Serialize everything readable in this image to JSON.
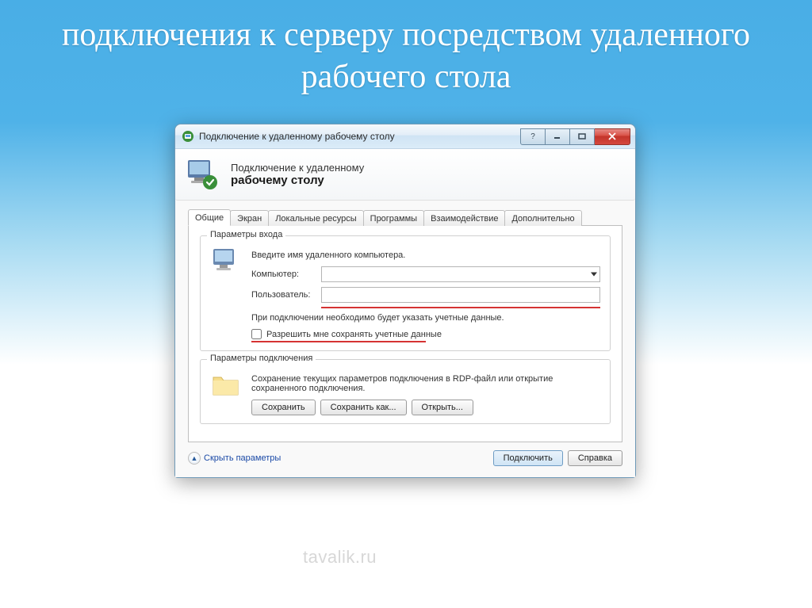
{
  "slide": {
    "title": "подключения к серверу посредством удаленного рабочего стола",
    "watermark": "tavalik.ru"
  },
  "window": {
    "title": "Подключение к удаленному рабочему столу",
    "header": {
      "line1": "Подключение к удаленному",
      "line2": "рабочему столу"
    },
    "tabs": [
      "Общие",
      "Экран",
      "Локальные ресурсы",
      "Программы",
      "Взаимодействие",
      "Дополнительно"
    ],
    "active_tab": "Общие",
    "login_group": {
      "title": "Параметры входа",
      "intro": "Введите имя удаленного компьютера.",
      "computer_label": "Компьютер:",
      "computer_value": "",
      "user_label": "Пользователь:",
      "user_value": "",
      "note": "При подключении необходимо будет указать учетные данные.",
      "checkbox_label": "Разрешить мне сохранять учетные данные",
      "checkbox_checked": false
    },
    "conn_group": {
      "title": "Параметры подключения",
      "text": "Сохранение текущих параметров подключения в RDP-файл или открытие сохраненного подключения.",
      "save": "Сохранить",
      "save_as": "Сохранить как...",
      "open": "Открыть..."
    },
    "bottom": {
      "hide_params": "Скрыть параметры",
      "connect": "Подключить",
      "help": "Справка"
    }
  }
}
